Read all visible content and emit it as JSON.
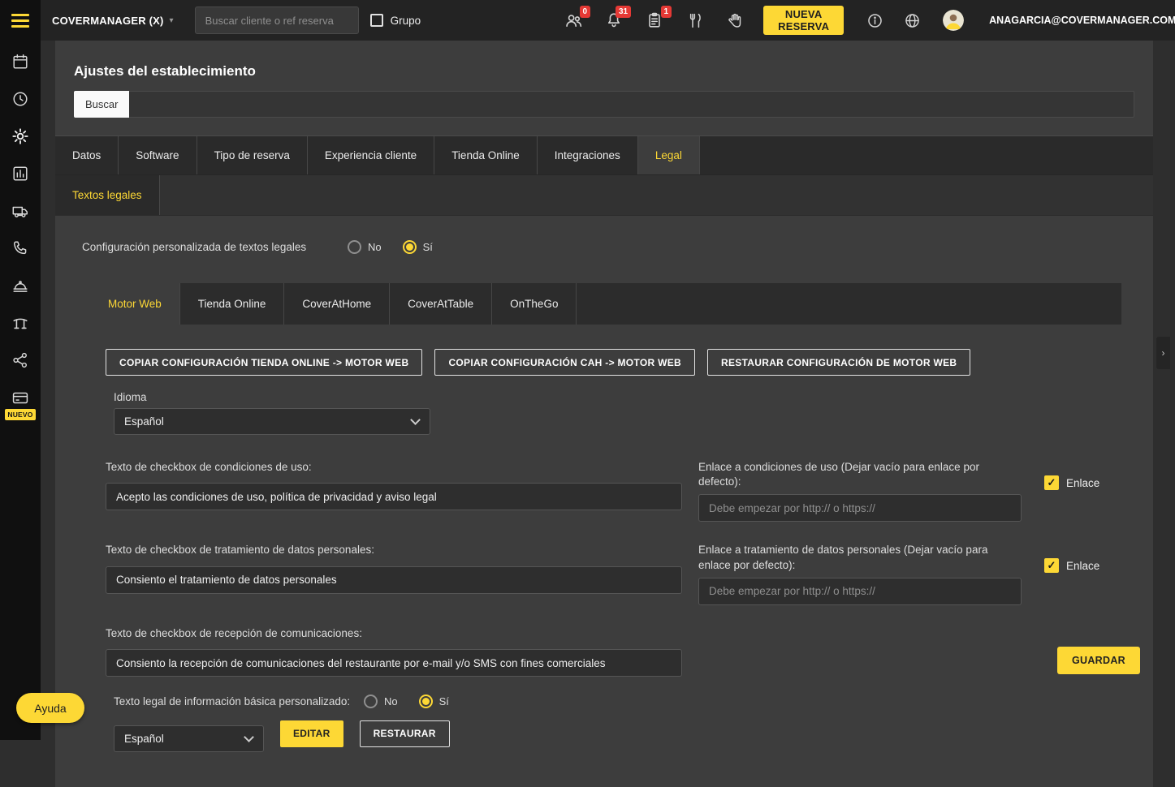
{
  "colors": {
    "accent": "#fdd835",
    "badge": "#e53935",
    "topbar_bg": "#232323",
    "sidebar_bg": "#101010",
    "panel_bg": "#3d3d3d"
  },
  "topbar": {
    "brand": "COVERMANAGER (X)",
    "search_placeholder": "Buscar cliente o ref reserva",
    "grupo_label": "Grupo",
    "badge_people": "0",
    "badge_notifications": "31",
    "badge_tasks": "1",
    "nueva_reserva_label": "NUEVA RESERVA",
    "user_email": "ANAGARCIA@COVERMANAGER.COM"
  },
  "sidebar": {
    "nuevo_badge": "NUEVO",
    "ayuda_label": "Ayuda"
  },
  "page": {
    "title": "Ajustes del establecimiento",
    "search_button": "Buscar",
    "tabs": [
      "Datos",
      "Software",
      "Tipo de reserva",
      "Experiencia cliente",
      "Tienda Online",
      "Integraciones",
      "Legal"
    ],
    "active_tab": "Legal",
    "subtab": "Textos legales",
    "config_label": "Configuración personalizada de textos legales",
    "radio_no": "No",
    "radio_si": "Sí",
    "config_selected": "Sí",
    "engine_tabs": [
      "Motor Web",
      "Tienda Online",
      "CoverAtHome",
      "CoverAtTable",
      "OnTheGo"
    ],
    "active_engine_tab": "Motor Web",
    "actions": [
      "COPIAR CONFIGURACIÓN TIENDA ONLINE -> MOTOR WEB",
      "COPIAR CONFIGURACIÓN CAH -> MOTOR WEB",
      "RESTAURAR CONFIGURACIÓN DE MOTOR WEB"
    ],
    "idioma_label": "Idioma",
    "idioma_value": "Español",
    "f1_label": "Texto de checkbox de condiciones de uso:",
    "f1_value": "Acepto las condiciones de uso, política de privacidad y aviso legal",
    "f2_label": "Texto de checkbox de tratamiento de datos personales:",
    "f2_value": "Consiento el tratamiento de datos personales",
    "f3_label": "Texto de checkbox de recepción de comunicaciones:",
    "f3_value": "Consiento la recepción de comunicaciones del restaurante por e-mail y/o SMS con fines comerciales",
    "l1_label": "Enlace a condiciones de uso (Dejar vacío para enlace por defecto):",
    "l2_label": "Enlace a tratamiento de datos personales (Dejar vacío para enlace por defecto):",
    "link_placeholder": "Debe empezar por http:// o https://",
    "enlace_label": "Enlace",
    "enlace_condiciones_checked": true,
    "enlace_tratamiento_checked": true,
    "legal_label": "Texto legal de información básica personalizado:",
    "legal_selected": "Sí",
    "legal_select_value": "Español",
    "editar_label": "EDITAR",
    "restaurar_label": "RESTAURAR",
    "guardar_label": "GUARDAR"
  }
}
